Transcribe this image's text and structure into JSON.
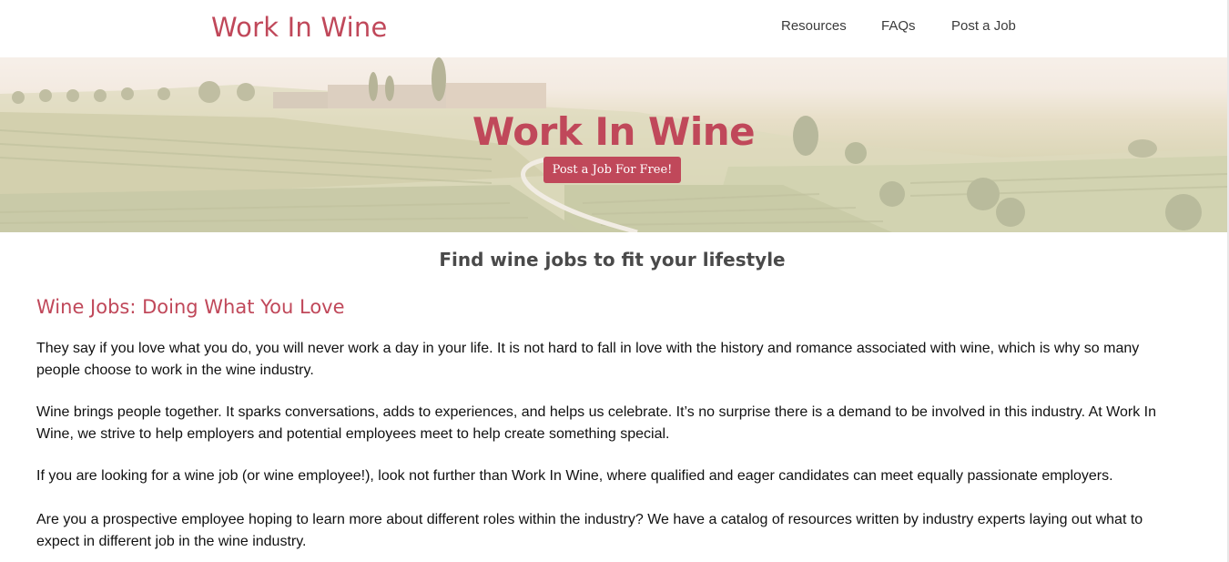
{
  "header": {
    "logo": "Work In Wine",
    "nav": [
      {
        "label": "Resources"
      },
      {
        "label": "FAQs"
      },
      {
        "label": "Post a Job"
      }
    ]
  },
  "hero": {
    "title": "Work In Wine",
    "button_label": "Post a Job For Free!"
  },
  "main": {
    "tagline": "Find wine jobs to fit your lifestyle",
    "heading": "Wine Jobs: Doing What You Love",
    "paragraphs": [
      "They say if you love what you do, you will never work a day in your life. It is not hard to fall in love with the history and romance associated with wine, which is why so many people choose to work in the wine industry.",
      "Wine brings people together. It sparks conversations, adds to experiences, and helps us celebrate. It’s no surprise there is a demand to be involved in this industry. At Work In Wine, we strive to help employers and potential employees meet to help create something special.",
      "If you are looking for a wine job (or wine employee!), look not further than Work In Wine, where qualified and eager candidates can meet equally passionate employers.",
      "Are you a prospective employee hoping to learn more about different roles within the industry? We have a catalog of resources written by industry experts laying out what to expect in different job in the wine industry."
    ]
  },
  "colors": {
    "brand": "#c0485a",
    "nav_text": "#3b3b3b",
    "body_text": "#111111"
  }
}
